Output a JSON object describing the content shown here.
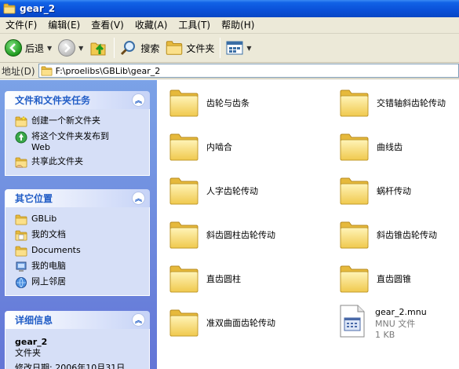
{
  "window": {
    "title": "gear_2"
  },
  "menu": [
    "文件(F)",
    "编辑(E)",
    "查看(V)",
    "收藏(A)",
    "工具(T)",
    "帮助(H)"
  ],
  "toolbar": {
    "back": "后退",
    "search": "搜索",
    "folders": "文件夹"
  },
  "address": {
    "label": "地址(D)",
    "path": "F:\\proelibs\\GBLib\\gear_2"
  },
  "tasks": {
    "title": "文件和文件夹任务",
    "items": [
      "创建一个新文件夹",
      "将这个文件夹发布到 Web",
      "共享此文件夹"
    ]
  },
  "places": {
    "title": "其它位置",
    "items": [
      "GBLib",
      "我的文档",
      "Documents",
      "我的电脑",
      "网上邻居"
    ]
  },
  "details": {
    "title": "详细信息",
    "name": "gear_2",
    "type": "文件夹",
    "modified": "修改日期: 2006年10月31日,"
  },
  "items": [
    {
      "name": "齿轮与齿条"
    },
    {
      "name": "交错轴斜齿轮传动"
    },
    {
      "name": "内啮合"
    },
    {
      "name": "曲线齿"
    },
    {
      "name": "人字齿轮传动"
    },
    {
      "name": "蜗杆传动"
    },
    {
      "name": "斜齿圆柱齿轮传动"
    },
    {
      "name": "斜齿锥齿轮传动"
    },
    {
      "name": "直齿圆柱"
    },
    {
      "name": "直齿圆锥"
    },
    {
      "name": "准双曲面齿轮传动"
    }
  ],
  "file": {
    "name": "gear_2.mnu",
    "type": "MNU 文件",
    "size": "1 KB"
  }
}
